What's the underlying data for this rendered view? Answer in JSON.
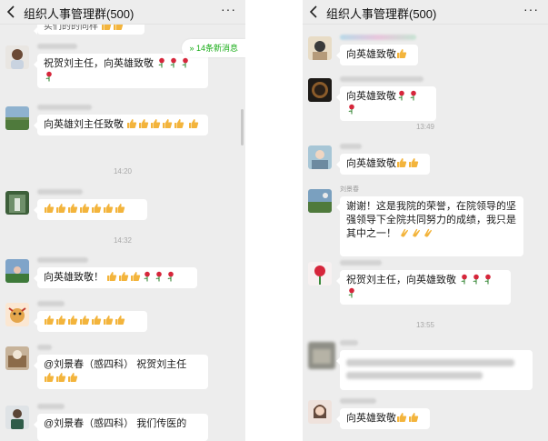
{
  "left": {
    "header": {
      "title": "组织人事管理群(500)",
      "more": "···"
    },
    "new_messages": "14条新消息",
    "top_partial": "实们的的同样",
    "m1": {
      "text": "祝贺刘主任，向英雄致敬"
    },
    "m2": {
      "text": "向英雄刘主任致敬"
    },
    "t1": "14:20",
    "t2": "14:32",
    "m4": {
      "text": "向英雄致敬！"
    },
    "m6": {
      "text": "@刘景春（感四科） 祝贺刘主任"
    },
    "m7": {
      "text": "@刘景春（感四科） 我们传医的"
    }
  },
  "right": {
    "header": {
      "title": "组织人事管理群(500)",
      "more": "···"
    },
    "r1": {
      "text": "向英雄致敬"
    },
    "t1": "13:49",
    "r3": {
      "text": "向英雄致敬"
    },
    "r4": {
      "sender": "刘景春",
      "text": "谢谢！这是我院的荣誉，在院领导的坚强领导下全院共同努力的成绩，我只是其中之一！"
    },
    "r5": {
      "text": "祝贺刘主任，向英雄致敬"
    },
    "t2": "13:55",
    "r7": {
      "text": "向英雄致敬"
    }
  },
  "icons": [
    "thumbs-up-icon",
    "rose-icon",
    "clap-icon",
    "back-chevron-icon",
    "more-icon"
  ],
  "colors": {
    "chat_bg": "#ededed",
    "bubble": "#ffffff",
    "accent_green": "#1aad19",
    "thumb": "#f3b43c",
    "rose": "#d6263b"
  }
}
